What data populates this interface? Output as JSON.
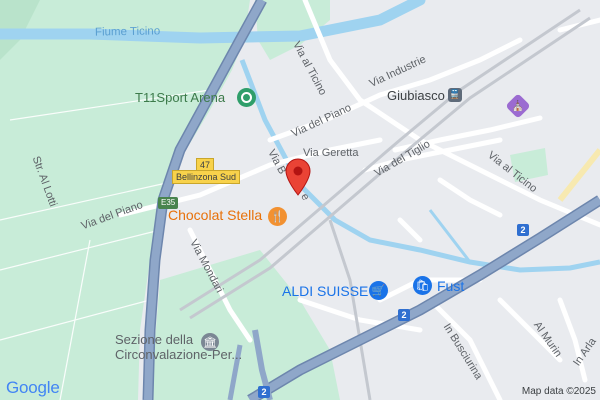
{
  "map": {
    "water_labels": {
      "river": "Fiume Ticino"
    },
    "street_labels": {
      "via_al_ticino_north": "Via al Ticino",
      "via_industrie": "Via Industrie",
      "via_del_piano_east": "Via del Piano",
      "via_geretta": "Via Geretta",
      "via_del_tiglio": "Via del Tiglio",
      "via_al_ticino_east": "Via al Ticino",
      "via_bellinzona_partial": "Via B",
      "via_bellinzona_tail": "e",
      "str_al_lotti": "Str. Al Lotti",
      "via_del_piano_west": "Via del Piano",
      "via_mondari": "Via Mondari",
      "in_busciurina": "In Busciurina",
      "al_murin": "Al Murin",
      "in_arla": "In Arla"
    },
    "place_labels": {
      "giubiasco": "Giubiasco",
      "t11sport": "T11Sport Arena",
      "chocolat": "Chocolat Stella",
      "aldi": "ALDI SUISSE",
      "fust": "Fust",
      "sezione": "Sezione della\nCirconvalazione-Per..."
    },
    "road_shields": {
      "route_47": "47",
      "bellinzona_sud": "Bellinzona Sud",
      "e35": "E35",
      "route_2_east": "2",
      "route_2_center": "2",
      "route_2_bottom": "2"
    },
    "icons": {
      "pin": "red-location-pin-icon",
      "sport": "stadium-icon",
      "food": "restaurant-icon",
      "shop": "shopping-cart-icon",
      "store": "shopping-bag-icon",
      "transit": "train-station-icon",
      "worship": "church-icon",
      "government": "government-building-icon"
    },
    "colors": {
      "land": "#e9ebef",
      "green": "#c8ecd8",
      "water": "#9fd3f0",
      "motorway": "#8fa7c9",
      "motorway_edge": "#6d86ad",
      "pin": "#ea4335",
      "food_poi": "#f29131",
      "shop_poi": "#1a73e8",
      "green_poi": "#2f9e6a",
      "worship_poi": "#9b6bd1",
      "gray_poi": "#7b8794"
    },
    "footer": {
      "logo": "Google",
      "attribution": "Map data ©2025"
    }
  }
}
